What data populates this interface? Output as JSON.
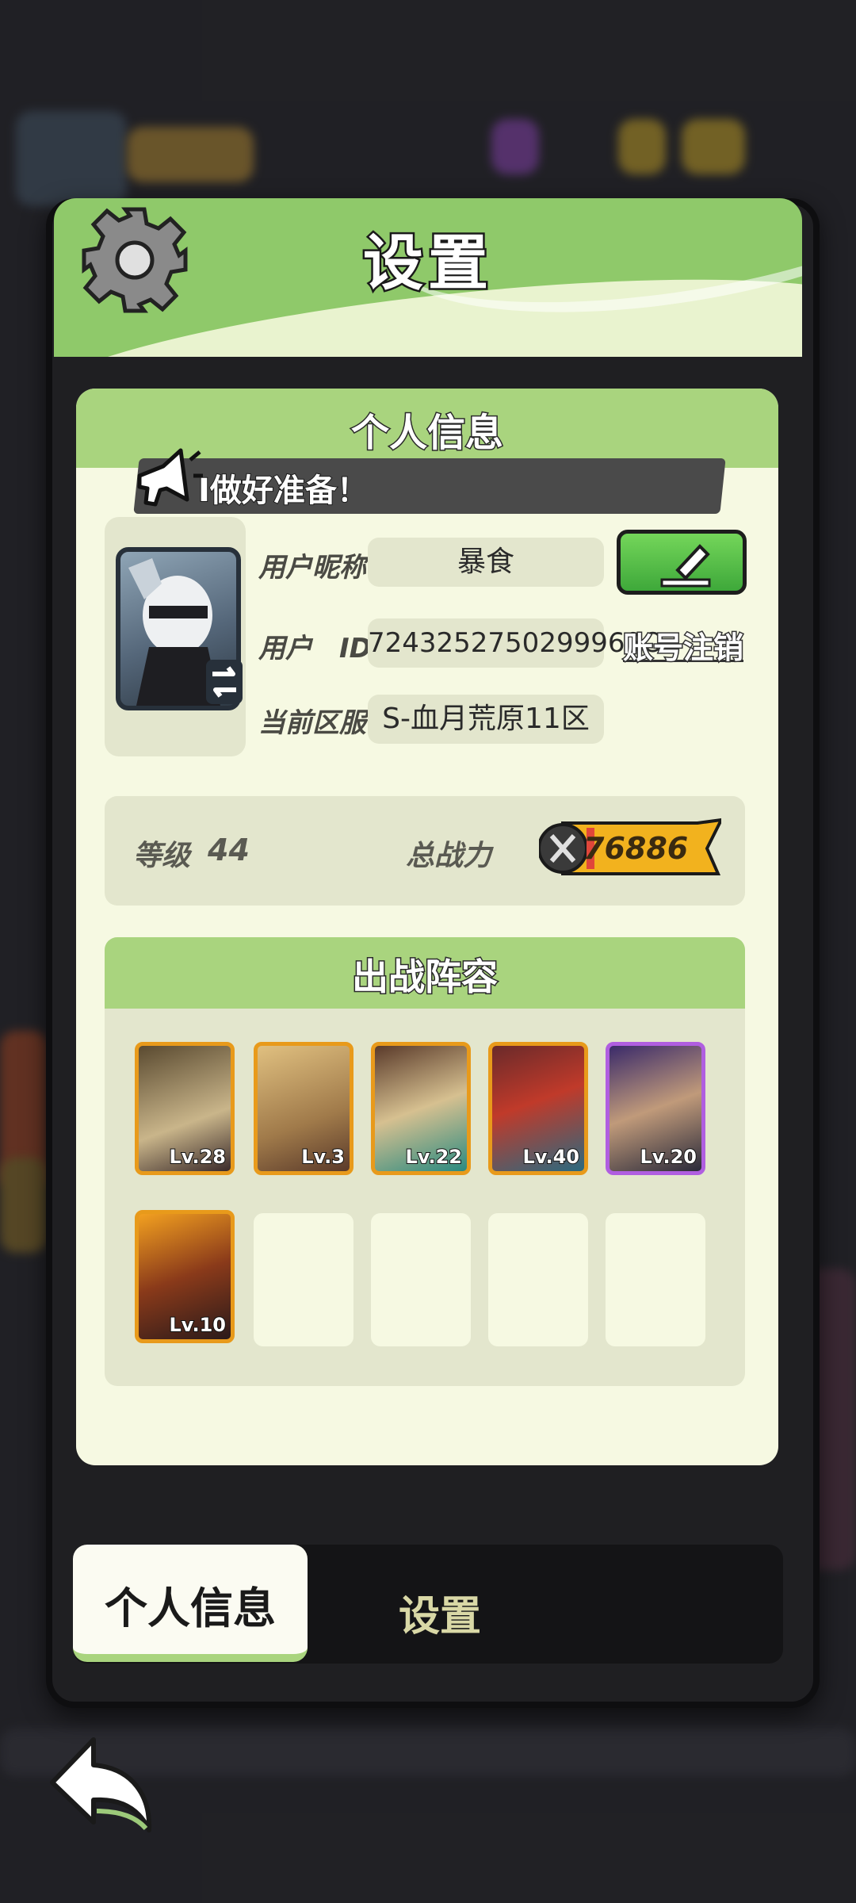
{
  "dialog": {
    "title": "设置",
    "panel_title": "个人信息",
    "announcement": "I做好准备！"
  },
  "profile": {
    "nickname_label": "用户昵称",
    "nickname": "暴食",
    "id_label": "用户　ID",
    "user_id": "7243252750299969O",
    "server_label": "当前区服",
    "server": "S-血月荒原11区",
    "logout_label": "账号注销"
  },
  "stats": {
    "level_label": "等级",
    "level": "44",
    "power_label": "总战力",
    "power": "76886"
  },
  "lineup": {
    "title": "出战阵容",
    "heroes": [
      {
        "lv": "Lv.28",
        "rarity": "gold"
      },
      {
        "lv": "Lv.3",
        "rarity": "gold"
      },
      {
        "lv": "Lv.22",
        "rarity": "gold"
      },
      {
        "lv": "Lv.40",
        "rarity": "gold"
      },
      {
        "lv": "Lv.20",
        "rarity": "purple"
      },
      {
        "lv": "Lv.10",
        "rarity": "gold"
      }
    ],
    "empty_slots": 4
  },
  "tabs": {
    "active": "个人信息",
    "other": "设置"
  },
  "colors": {
    "accent_green": "#a9d47e",
    "panel_bg": "#f6f9e2",
    "hero_gold": "#e89a1b",
    "hero_purple": "#b05ee0"
  }
}
